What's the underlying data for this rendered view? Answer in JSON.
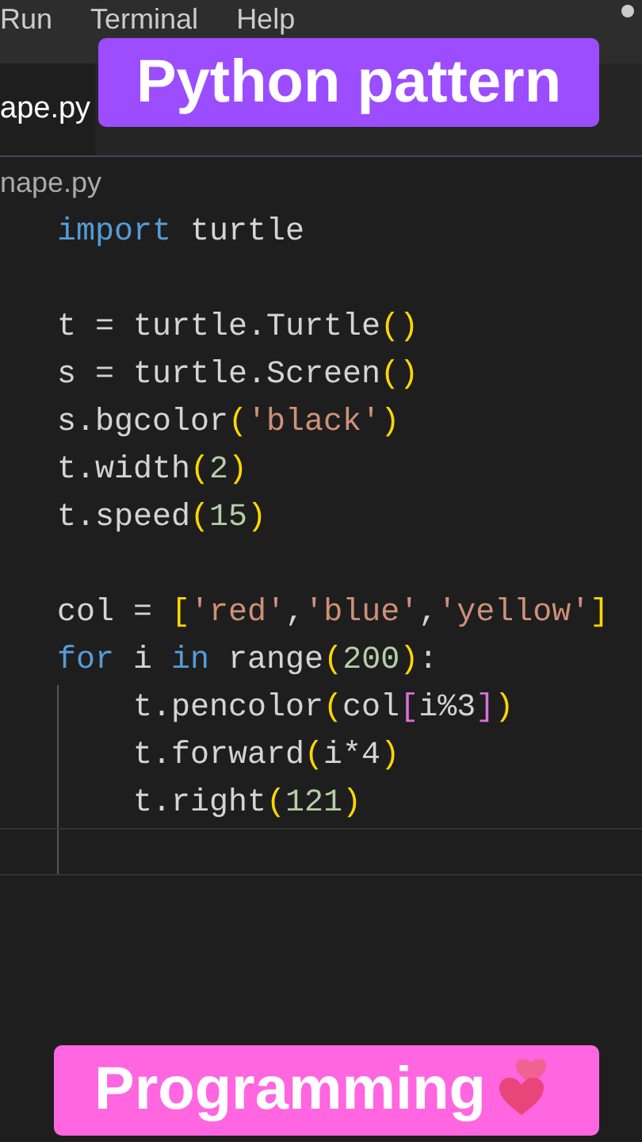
{
  "menu": [
    "Run",
    "Terminal",
    "Help"
  ],
  "tab": {
    "label": "ape.py",
    "selected": true
  },
  "breadcrumb": "nape.py",
  "code": [
    {
      "indent": false,
      "current": false,
      "tokens": [
        {
          "t": "import",
          "kind": "keyword"
        },
        {
          "t": " turtle",
          "kind": "plain"
        }
      ]
    },
    {
      "indent": false,
      "current": false
    },
    {
      "indent": false,
      "current": false,
      "tokens": [
        {
          "t": "t = turtle.Turtle",
          "kind": "plain"
        },
        {
          "t": "()",
          "kind": "bracket"
        }
      ]
    },
    {
      "indent": false,
      "current": false,
      "tokens": [
        {
          "t": "s = turtle.Screen",
          "kind": "plain"
        },
        {
          "t": "()",
          "kind": "bracket"
        }
      ]
    },
    {
      "indent": false,
      "current": false,
      "tokens": [
        {
          "t": "s.bgcolor",
          "kind": "plain"
        },
        {
          "t": "(",
          "kind": "bracket"
        },
        {
          "t": "'black'",
          "kind": "string"
        },
        {
          "t": ")",
          "kind": "bracket"
        }
      ]
    },
    {
      "indent": false,
      "current": false,
      "tokens": [
        {
          "t": "t.width",
          "kind": "plain"
        },
        {
          "t": "(",
          "kind": "bracket"
        },
        {
          "t": "2",
          "kind": "number"
        },
        {
          "t": ")",
          "kind": "bracket"
        }
      ]
    },
    {
      "indent": false,
      "current": false,
      "tokens": [
        {
          "t": "t.speed",
          "kind": "plain"
        },
        {
          "t": "(",
          "kind": "bracket"
        },
        {
          "t": "15",
          "kind": "number"
        },
        {
          "t": ")",
          "kind": "bracket"
        }
      ]
    },
    {
      "indent": false,
      "current": false
    },
    {
      "indent": false,
      "current": false,
      "tokens": [
        {
          "t": "col = ",
          "kind": "plain"
        },
        {
          "t": "[",
          "kind": "bracket"
        },
        {
          "t": "'red'",
          "kind": "string"
        },
        {
          "t": ",",
          "kind": "plain"
        },
        {
          "t": "'blue'",
          "kind": "string"
        },
        {
          "t": ",",
          "kind": "plain"
        },
        {
          "t": "'yellow'",
          "kind": "string"
        },
        {
          "t": "]",
          "kind": "bracket"
        }
      ]
    },
    {
      "indent": false,
      "current": false,
      "tokens": [
        {
          "t": "for",
          "kind": "keyword"
        },
        {
          "t": " i ",
          "kind": "plain"
        },
        {
          "t": "in",
          "kind": "keyword"
        },
        {
          "t": " range",
          "kind": "plain"
        },
        {
          "t": "(",
          "kind": "bracket"
        },
        {
          "t": "200",
          "kind": "number"
        },
        {
          "t": ")",
          "kind": "bracket"
        },
        {
          "t": ":",
          "kind": "plain"
        }
      ]
    },
    {
      "indent": true,
      "current": false,
      "tokens": [
        {
          "t": "t.pencolor",
          "kind": "plain"
        },
        {
          "t": "(",
          "kind": "bracket"
        },
        {
          "t": "col",
          "kind": "plain"
        },
        {
          "t": "[",
          "kind": "bracket2"
        },
        {
          "t": "i%3",
          "kind": "plain"
        },
        {
          "t": "]",
          "kind": "bracket2"
        },
        {
          "t": ")",
          "kind": "bracket"
        }
      ]
    },
    {
      "indent": true,
      "current": false,
      "tokens": [
        {
          "t": "t.forward",
          "kind": "plain"
        },
        {
          "t": "(",
          "kind": "bracket"
        },
        {
          "t": "i*4",
          "kind": "plain"
        },
        {
          "t": ")",
          "kind": "bracket"
        }
      ]
    },
    {
      "indent": true,
      "current": false,
      "tokens": [
        {
          "t": "t.right",
          "kind": "plain"
        },
        {
          "t": "(",
          "kind": "bracket"
        },
        {
          "t": "121",
          "kind": "number"
        },
        {
          "t": ")",
          "kind": "bracket"
        }
      ]
    },
    {
      "indent": true,
      "current": true
    }
  ],
  "overlay_top": "Python pattern",
  "overlay_bottom": "Programming"
}
